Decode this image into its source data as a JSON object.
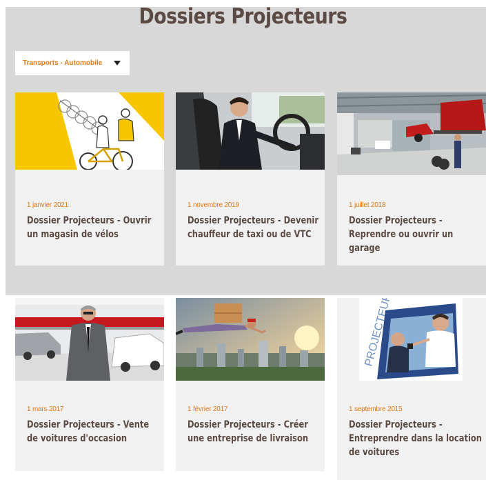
{
  "header": {
    "title": "Dossiers Projecteurs"
  },
  "filter": {
    "selected": "Transports - Automobile"
  },
  "articles": [
    {
      "date": "1 janvier 2021",
      "title": "Dossier Projecteurs - Ouvrir un magasin de vélos"
    },
    {
      "date": "1 novembre 2019",
      "title": "Dossier Projecteurs - Devenir chauffeur de taxi ou de VTC"
    },
    {
      "date": "1 juillet 2018",
      "title": "Dossier Projecteurs - Reprendre ou ouvrir un garage"
    },
    {
      "date": "1 mars 2017",
      "title": "Dossier Projecteurs - Vente de voitures d'occasion"
    },
    {
      "date": "1 février 2017",
      "title": "Dossier Projecteurs - Créer une entreprise de livraison"
    },
    {
      "date": "1 septembre 2015",
      "title": "Dossier Projecteurs - Entreprendre dans la location de voitures"
    }
  ],
  "images": {
    "logo_text": "PROJECTEURS"
  },
  "colors": {
    "accent": "#e17a14",
    "title": "#5b4a43",
    "panel": "#d8d8d8",
    "card": "#f2f1f2"
  }
}
